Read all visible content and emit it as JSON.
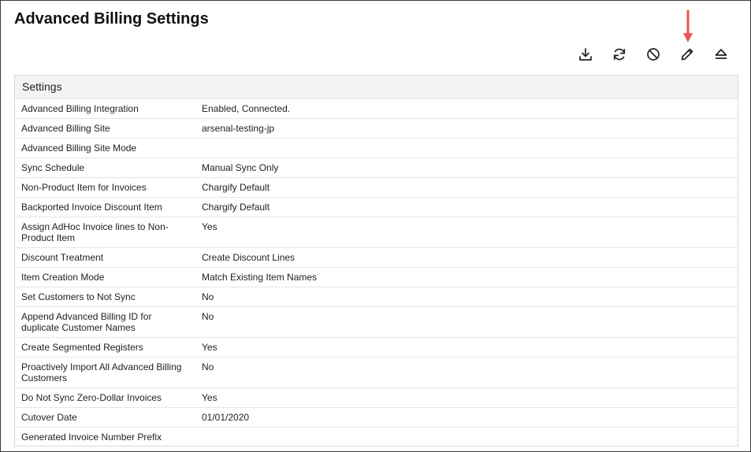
{
  "page": {
    "title": "Advanced Billing Settings"
  },
  "toolbar": {
    "buttons": [
      {
        "name": "download-icon",
        "label": "Download"
      },
      {
        "name": "refresh-icon",
        "label": "Sync"
      },
      {
        "name": "disable-icon",
        "label": "Disable"
      },
      {
        "name": "edit-icon",
        "label": "Edit"
      },
      {
        "name": "eject-icon",
        "label": "Disconnect"
      }
    ],
    "highlight_color": "#e8574a"
  },
  "settings": {
    "header": "Settings",
    "rows": [
      {
        "label": "Advanced Billing Integration",
        "value": "Enabled, Connected."
      },
      {
        "label": "Advanced Billing Site",
        "value": "arsenal-testing-jp"
      },
      {
        "label": "Advanced Billing Site Mode",
        "value": ""
      },
      {
        "label": "Sync Schedule",
        "value": "Manual Sync Only"
      },
      {
        "label": "Non-Product Item for Invoices",
        "value": "Chargify Default"
      },
      {
        "label": "Backported Invoice Discount Item",
        "value": "Chargify Default"
      },
      {
        "label": "Assign AdHoc Invoice lines to Non-Product Item",
        "value": "Yes"
      },
      {
        "label": "Discount Treatment",
        "value": "Create Discount Lines"
      },
      {
        "label": "Item Creation Mode",
        "value": "Match Existing Item Names"
      },
      {
        "label": "Set Customers to Not Sync",
        "value": "No"
      },
      {
        "label": "Append Advanced Billing ID for duplicate Customer Names",
        "value": "No"
      },
      {
        "label": "Create Segmented Registers",
        "value": "Yes"
      },
      {
        "label": "Proactively Import All Advanced Billing Customers",
        "value": "No"
      },
      {
        "label": "Do Not Sync Zero-Dollar Invoices",
        "value": "Yes"
      },
      {
        "label": "Cutover Date",
        "value": "01/01/2020"
      },
      {
        "label": "Generated Invoice Number Prefix",
        "value": ""
      }
    ]
  }
}
